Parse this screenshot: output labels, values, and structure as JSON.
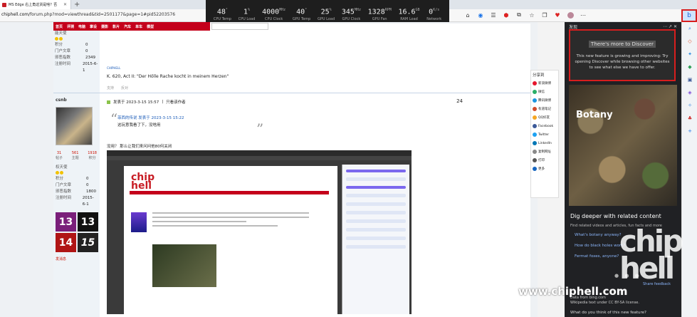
{
  "tab": {
    "title": "MS Edge 右上角这货是啥？否"
  },
  "url": {
    "prefix": "chiphell.com",
    "path": "/forum.php?mod=viewthread&tid=2501177&page=1#pid52203576"
  },
  "hw": [
    {
      "value": "48",
      "unit": "°",
      "label": "CPU Temp"
    },
    {
      "value": "1",
      "unit": "%",
      "label": "CPU Load"
    },
    {
      "value": "4000",
      "unit": "MHz",
      "label": "CPU Clock"
    },
    {
      "value": "40",
      "unit": "°",
      "label": "GPU Temp"
    },
    {
      "value": "25",
      "unit": "%",
      "label": "GPU Load"
    },
    {
      "value": "345",
      "unit": "MHz",
      "label": "GPU Clock"
    },
    {
      "value": "1328",
      "unit": "RPM",
      "label": "GPU Fan"
    },
    {
      "value": "16.6",
      "unit": "GB",
      "label": "RAM Load"
    },
    {
      "value": "0",
      "unit": "K/s",
      "label": "Network"
    }
  ],
  "nav": [
    "首页",
    "评测",
    "电脑",
    "掌设",
    "摄影",
    "影片",
    "汽车",
    "单车",
    "模型"
  ],
  "post1": {
    "fields": [
      [
        "能天使",
        ""
      ],
      [
        "积分",
        "0"
      ],
      [
        "门户文章",
        "0"
      ],
      [
        "邪恶指数",
        "2349"
      ],
      [
        "注册时间",
        "2015-6-1"
      ]
    ],
    "sig": "CHIPHELL",
    "text": "K. 620, Act II: \"Der Hölle Rache kocht in meinem Herzen\"",
    "support": "支持",
    "oppose": "反对"
  },
  "post2": {
    "user": "csnb",
    "stats": [
      [
        "31",
        "帖子"
      ],
      [
        "561",
        "主题"
      ],
      [
        "1918",
        "积分"
      ]
    ],
    "fields": [
      [
        "权天使",
        ""
      ],
      [
        "积分",
        "0"
      ],
      [
        "门户文章",
        "0"
      ],
      [
        "邪恶指数",
        "1800"
      ],
      [
        "注册时间",
        "2015-6-1"
      ]
    ],
    "medals": [
      "13",
      "13",
      "14",
      "15"
    ],
    "report": "发消息",
    "posted": "发表于 2023-3-15 15:57",
    "only_author": "只看该作者",
    "floor": "24",
    "quote_meta": "菲西的传说 发表于 2023-3-15 15:22",
    "quote_text": "这玩意我看了下，没啥用",
    "ask": "没用？ 那么让我们来问问他80何关闭"
  },
  "share": {
    "title": "分享到",
    "items": [
      "新浪微博",
      "微信",
      "腾讯微博",
      "有道笔记",
      "QQ好友",
      "Facebook",
      "Twitter",
      "LinkedIn",
      "复制网址",
      "打印",
      "更多"
    ]
  },
  "discover": {
    "title": "发现",
    "callout_heading": "There's more to Discover",
    "callout_text": "This new feature is growing and improving: Try opening Discover while browsing other websites to see what else we have to offer.",
    "botany": "Botany",
    "dig": "Dig deeper with related content",
    "related": "Find related videos and articles, fun facts and more",
    "links": [
      "What's botany anyway?",
      "How do black holes work?",
      "Fermat foxes, anyone?"
    ],
    "send_feedback": "Share feedback",
    "footer": "Data from bing.com\nWikipedia text under CC BY-SA license.",
    "ask": "What do you think of this new feature?"
  },
  "watermark": "www.chiphell.com",
  "wlogo": "chip hell"
}
